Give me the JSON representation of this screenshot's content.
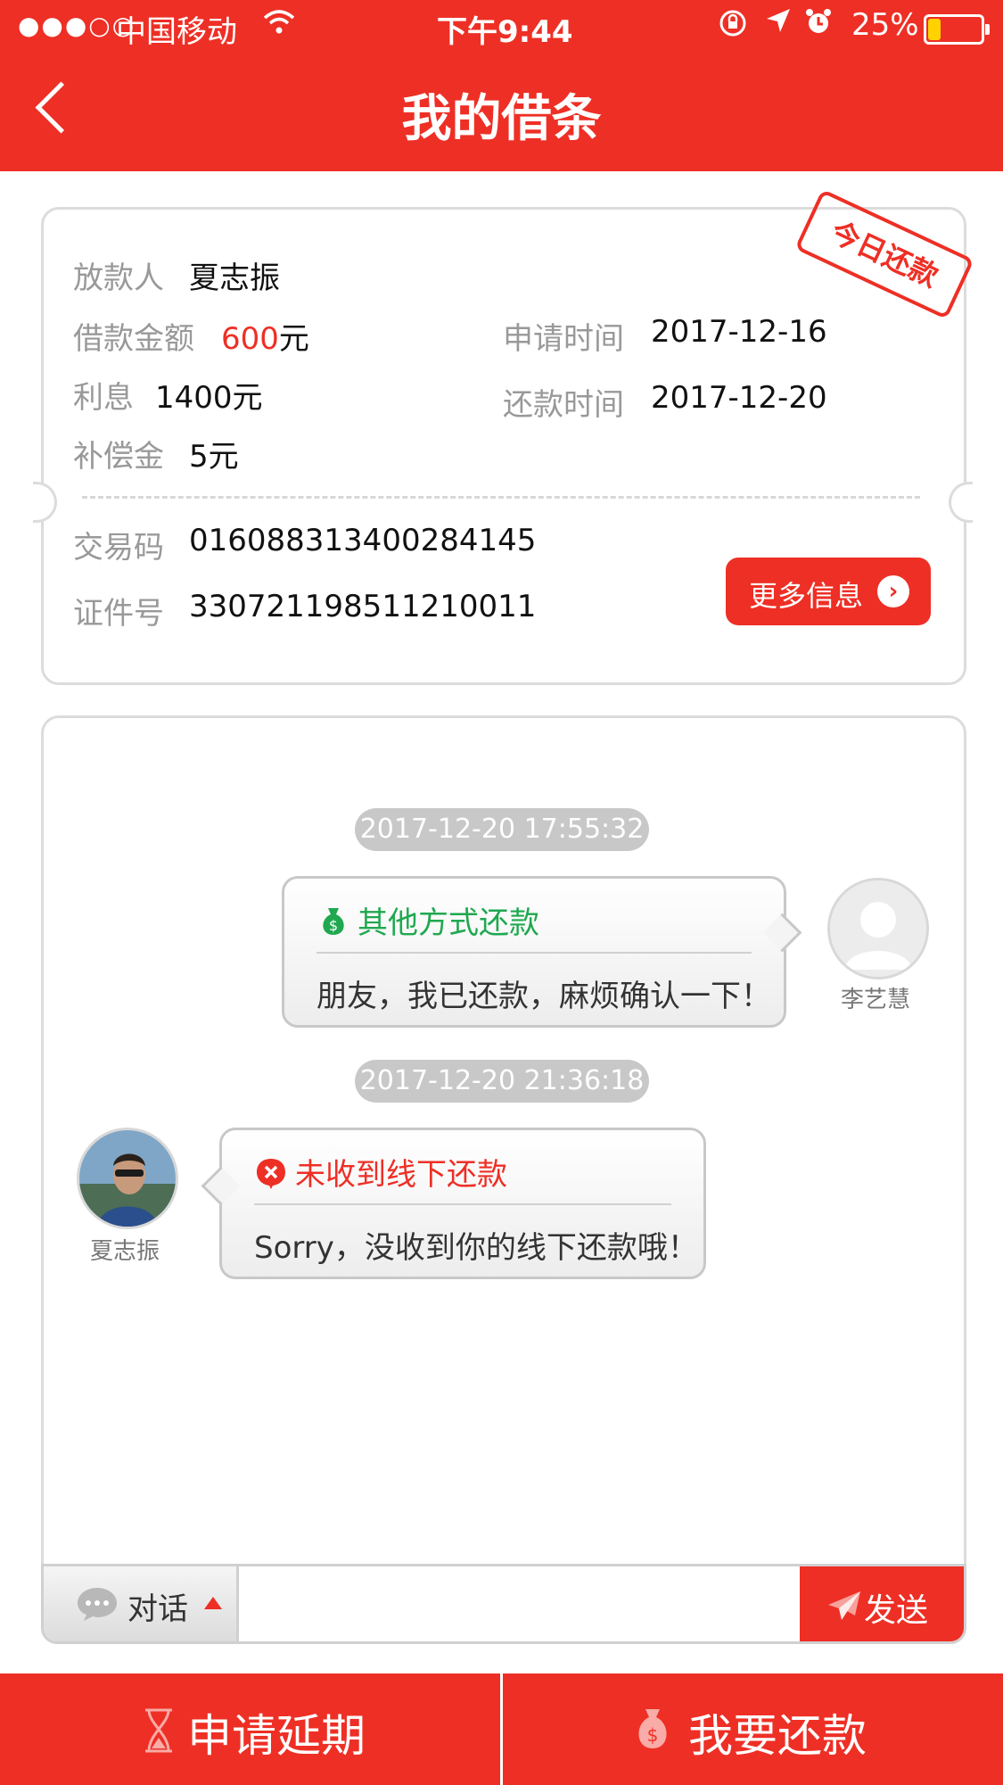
{
  "status_bar": {
    "signal": "●●●○○",
    "carrier": "中国移动",
    "time": "下午9:44",
    "battery_pct": "25%",
    "battery_level": 0.25
  },
  "nav": {
    "title": "我的借条"
  },
  "loan": {
    "lender_label": "放款人",
    "lender_name": "夏志振",
    "amount_label": "借款金额",
    "amount_value": "600",
    "amount_unit": "元",
    "interest_label": "利息",
    "interest_value": "1400元",
    "compensation_label": "补偿金",
    "compensation_value": "5元",
    "apply_time_label": "申请时间",
    "apply_time_value": "2017-12-16",
    "repay_time_label": "还款时间",
    "repay_time_value": "2017-12-20",
    "stamp": "今日还款",
    "trade_code_label": "交易码",
    "trade_code_value": "016088313400284145",
    "id_label": "证件号",
    "id_value": "330721198511210011",
    "more_button": "更多信息"
  },
  "chat": {
    "messages": [
      {
        "time": "2017-12-20 17:55:32",
        "title": "其他方式还款",
        "body": "朋友，我已还款，麻烦确认一下！",
        "sender": "李艺慧",
        "side": "right",
        "title_color": "#1fa84f",
        "icon": "money-bag-icon"
      },
      {
        "time": "2017-12-20 21:36:18",
        "title": "未收到线下还款",
        "body": "Sorry，没收到你的线下还款哦！",
        "sender": "夏志振",
        "side": "left",
        "title_color": "#ee2f25",
        "icon": "close-circle-icon"
      }
    ]
  },
  "input_bar": {
    "mode_label": "对话",
    "input_value": "",
    "input_placeholder": "",
    "send_label": "发送"
  },
  "bottom_bar": {
    "extend_label": "申请延期",
    "repay_label": "我要还款"
  },
  "colors": {
    "primary": "#ee2f25",
    "success": "#1fa84f",
    "label": "#999999"
  }
}
